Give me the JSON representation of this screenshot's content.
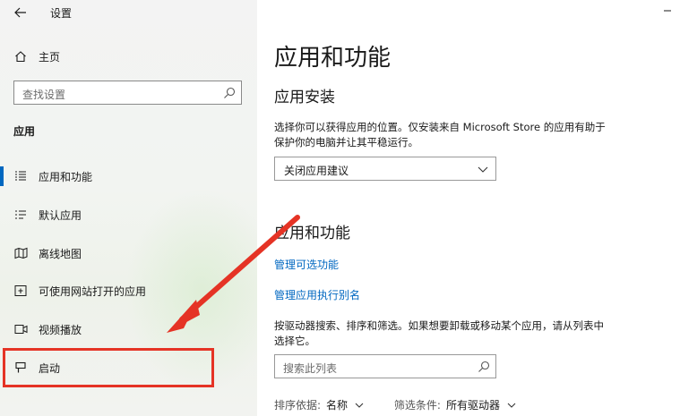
{
  "window": {
    "title": "设置"
  },
  "sidebar": {
    "home_label": "主页",
    "search_placeholder": "查找设置",
    "section_heading": "应用",
    "items": [
      {
        "label": "应用和功能",
        "icon": "list-icon",
        "active": true
      },
      {
        "label": "默认应用",
        "icon": "default-apps-icon"
      },
      {
        "label": "离线地图",
        "icon": "map-icon"
      },
      {
        "label": "可使用网站打开的应用",
        "icon": "web-app-icon"
      },
      {
        "label": "视频播放",
        "icon": "video-icon"
      },
      {
        "label": "启动",
        "icon": "startup-icon"
      }
    ]
  },
  "main": {
    "title": "应用和功能",
    "install_heading": "应用安装",
    "install_desc_line1": "选择你可以获得应用的位置。仅安装来自 Microsoft Store 的应用有助于",
    "install_desc_line2": "保护你的电脑并让其平稳运行。",
    "install_dropdown_value": "关闭应用建议",
    "apps_heading": "应用和功能",
    "link_optional_features": "管理可选功能",
    "link_app_aliases": "管理应用执行别名",
    "search_desc_line1": "按驱动器搜索、排序和筛选。如果想要卸载或移动某个应用，请从列表中",
    "search_desc_line2": "选择它。",
    "search_list_placeholder": "搜索此列表",
    "sort_label": "排序依据:",
    "sort_value": "名称",
    "filter_label": "筛选条件:",
    "filter_value": "所有驱动器"
  },
  "colors": {
    "accent": "#0067c0",
    "annotation": "#e53325"
  }
}
